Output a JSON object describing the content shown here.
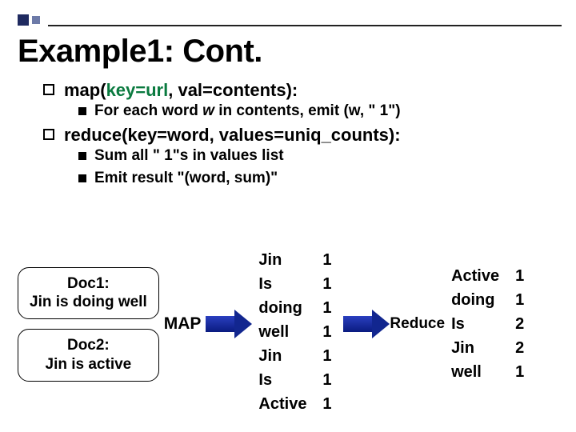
{
  "title": "Example1: Cont.",
  "bullets": {
    "map": {
      "prefix": "map(",
      "key": "key=url",
      "rest": ", val=contents):",
      "sub1_a": "For each word ",
      "sub1_w": "w",
      "sub1_b": " in contents, emit (w, \" 1\")"
    },
    "reduce": {
      "line": "reduce(key=word, values=uniq_counts):",
      "sub1": "Sum all \" 1\"s in values list",
      "sub2": "Emit result \"(word, sum)\""
    }
  },
  "diagram": {
    "doc1_title": "Doc1:",
    "doc1_text": "Jin is doing well",
    "doc2_title": "Doc2:",
    "doc2_text": "Jin is active",
    "map_label": "MAP",
    "reduce_label": "Reduce",
    "map_out": [
      {
        "w": "Jin",
        "n": "1"
      },
      {
        "w": "Is",
        "n": "1"
      },
      {
        "w": "doing",
        "n": "1"
      },
      {
        "w": "well",
        "n": "1"
      },
      {
        "w": "Jin",
        "n": "1"
      },
      {
        "w": "Is",
        "n": "1"
      },
      {
        "w": "Active",
        "n": "1"
      }
    ],
    "reduce_out": [
      {
        "w": "Active",
        "n": "1"
      },
      {
        "w": "doing",
        "n": "1"
      },
      {
        "w": "Is",
        "n": "2"
      },
      {
        "w": "Jin",
        "n": "2"
      },
      {
        "w": "well",
        "n": "1"
      }
    ]
  }
}
